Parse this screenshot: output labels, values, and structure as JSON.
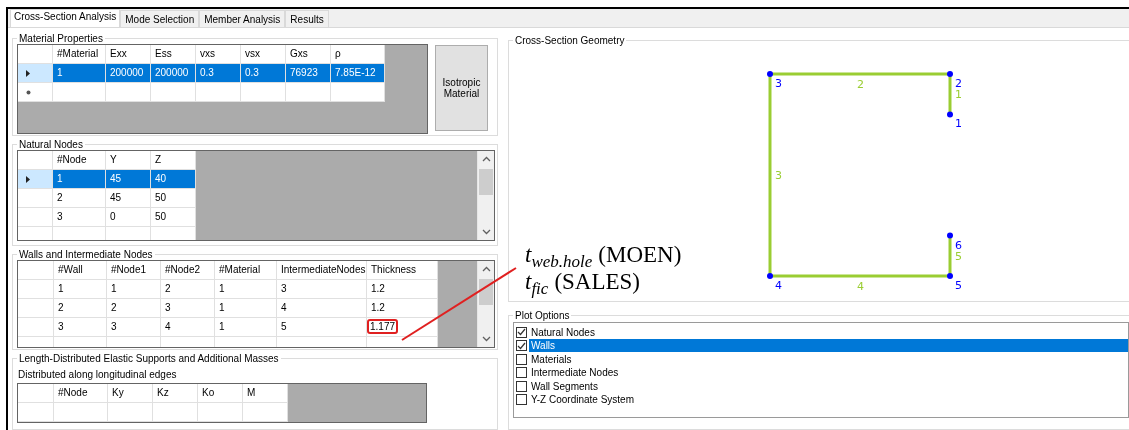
{
  "tabs": [
    {
      "label": "Cross-Section Analysis",
      "selected": true
    },
    {
      "label": "Mode Selection",
      "selected": false
    },
    {
      "label": "Member Analysis",
      "selected": false
    },
    {
      "label": "Results",
      "selected": false
    }
  ],
  "material_properties": {
    "title": "Material Properties",
    "columns": [
      "#Material",
      "Exx",
      "Ess",
      "vxs",
      "vsx",
      "Gxs",
      "ρ"
    ],
    "rows": [
      {
        "cells": [
          "1",
          "200000",
          "200000",
          "0.3",
          "0.3",
          "76923",
          "7.85E-12"
        ],
        "selected": true
      }
    ],
    "new_row": true,
    "button": "Isotropic Material"
  },
  "natural_nodes": {
    "title": "Natural Nodes",
    "columns": [
      "#Node",
      "Y",
      "Z"
    ],
    "rows": [
      {
        "cells": [
          "1",
          "45",
          "40"
        ],
        "selected": true
      },
      {
        "cells": [
          "2",
          "45",
          "50"
        ],
        "selected": false
      },
      {
        "cells": [
          "3",
          "0",
          "50"
        ],
        "selected": false
      }
    ]
  },
  "walls": {
    "title": "Walls and Intermediate Nodes",
    "columns": [
      "#Wall",
      "#Node1",
      "#Node2",
      "#Material",
      "IntermediateNodes",
      "Thickness"
    ],
    "rows": [
      {
        "cells": [
          "1",
          "1",
          "2",
          "1",
          "3",
          "1.2"
        ],
        "selected": false,
        "highlighted": false
      },
      {
        "cells": [
          "2",
          "2",
          "3",
          "1",
          "4",
          "1.2"
        ],
        "selected": false,
        "highlighted": false
      },
      {
        "cells": [
          "3",
          "3",
          "4",
          "1",
          "5",
          "1.177"
        ],
        "selected": false,
        "highlighted": true
      }
    ]
  },
  "supports": {
    "title": "Length-Distributed Elastic Supports and Additional Masses",
    "subtitle": "Distributed along longitudinal edges",
    "columns": [
      "#Node",
      "Ky",
      "Kz",
      "Ko",
      "M"
    ]
  },
  "geometry": {
    "title": "Cross-Section Geometry",
    "nodes": [
      "3",
      "2",
      "1",
      "6",
      "4",
      "5"
    ],
    "walls": [
      "2",
      "1",
      "3",
      "5",
      "4"
    ]
  },
  "annotation": {
    "lines": [
      {
        "symbol": "t",
        "subscript": "web.hole",
        "label": "(MOEN)"
      },
      {
        "symbol": "t",
        "subscript": "fic",
        "label": "(SALES)"
      }
    ]
  },
  "plot_options": {
    "title": "Plot Options",
    "items": [
      {
        "label": "Natural Nodes",
        "checked": true,
        "selected": false
      },
      {
        "label": "Walls",
        "checked": true,
        "selected": true
      },
      {
        "label": "Materials",
        "checked": false,
        "selected": false
      },
      {
        "label": "Intermediate Nodes",
        "checked": false,
        "selected": false
      },
      {
        "label": "Wall Segments",
        "checked": false,
        "selected": false
      },
      {
        "label": "Y-Z Coordinate System",
        "checked": false,
        "selected": false
      }
    ]
  }
}
